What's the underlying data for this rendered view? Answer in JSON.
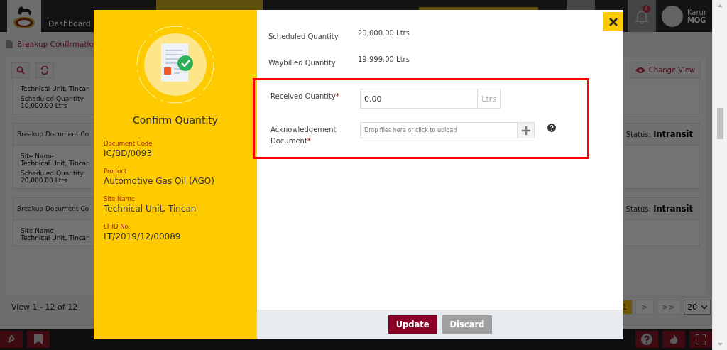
{
  "nav": {
    "items": [
      {
        "label": "Dashboard",
        "selected": false
      }
    ],
    "notification_count": "4",
    "user": {
      "name": "Karur",
      "role": "MOG"
    }
  },
  "page": {
    "title": "Breakup Confirmatio",
    "change_view": "Change View"
  },
  "cards": [
    {
      "fields": [
        {
          "value": "Technical Unit, Tincan"
        },
        {
          "label": "Scheduled Quantity",
          "value": "10,000.00 Ltrs"
        }
      ]
    },
    {
      "header": "Breakup Document Co",
      "status_label": "Status:",
      "status": "Intransit",
      "fields": [
        {
          "label": "Site Name",
          "value": "Technical Unit, Tincan"
        },
        {
          "label": "Scheduled Quantity",
          "value": "20,000.00 Ltrs"
        }
      ]
    },
    {
      "header": "Breakup Document Co",
      "status_label": "Status:",
      "status": "Intransit",
      "fields": [
        {
          "label": "Site Name",
          "value": "Technical Unit, Tincan"
        }
      ]
    }
  ],
  "pager": {
    "summary": "View 1 - 12 of 12",
    "buttons": [
      {
        "label": "1",
        "selected": true
      },
      {
        "label": ">",
        "selected": false
      },
      {
        "label": ">>",
        "selected": false
      }
    ],
    "page_size": "20"
  },
  "modal": {
    "title": "Confirm Quantity",
    "details": [
      {
        "label": "Document Code",
        "value": "IC/BD/0093"
      },
      {
        "label": "Product",
        "value": "Automotive Gas Oil (AGO)"
      },
      {
        "label": "Site Name",
        "value": "Technical Unit, Tincan"
      },
      {
        "label": "LT ID No.",
        "value": "LT/2019/12/00089"
      }
    ],
    "readonly_fields": [
      {
        "label": "Scheduled Quantity",
        "value": "20,000.00 Ltrs"
      },
      {
        "label": "Waybilled Quantity",
        "value": "19,999.00 Ltrs"
      }
    ],
    "input_fields_highlighted": true,
    "input_fields": [
      {
        "kind": "number",
        "label": "Received Quantity",
        "required_mark": "*",
        "value": "0.00",
        "unit": "Ltrs"
      },
      {
        "kind": "file",
        "label": "Acknowledgement Document",
        "required_mark": "*",
        "placeholder": "Drop files here or click to upload",
        "help": true
      }
    ],
    "buttons": [
      {
        "label": "Update",
        "kind": "primary"
      },
      {
        "label": "Discard",
        "kind": "secondary"
      }
    ]
  }
}
